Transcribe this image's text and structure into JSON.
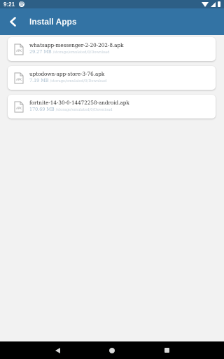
{
  "status_bar": {
    "time": "9:21",
    "notification_glyph": "⊜",
    "icons": [
      "wifi-icon",
      "signal-icon",
      "battery-icon"
    ]
  },
  "app_bar": {
    "title": "Install Apps",
    "back_icon": "chevron-left-icon"
  },
  "files": [
    {
      "name": "whatsapp-messenger-2-20-202-8.apk",
      "size": "29.27 MB",
      "path": "/storage/emulated/0/Download"
    },
    {
      "name": "uptodown-app-store-3-76.apk",
      "size": "7.19 MB",
      "path": "/storage/emulated/0/Download"
    },
    {
      "name": "fortnite-14-30-0-14472258-android.apk",
      "size": "170.69 MB",
      "path": "/storage/emulated/0/Download"
    }
  ],
  "file_icon_label": "APK",
  "nav_bar": {
    "icons": [
      "back-triangle-icon",
      "home-circle-icon",
      "recents-square-icon"
    ]
  },
  "colors": {
    "status_bar": "#2d5f86",
    "app_bar": "#3373a4",
    "background": "#f2f2f2",
    "size_text": "#a7bccd"
  }
}
